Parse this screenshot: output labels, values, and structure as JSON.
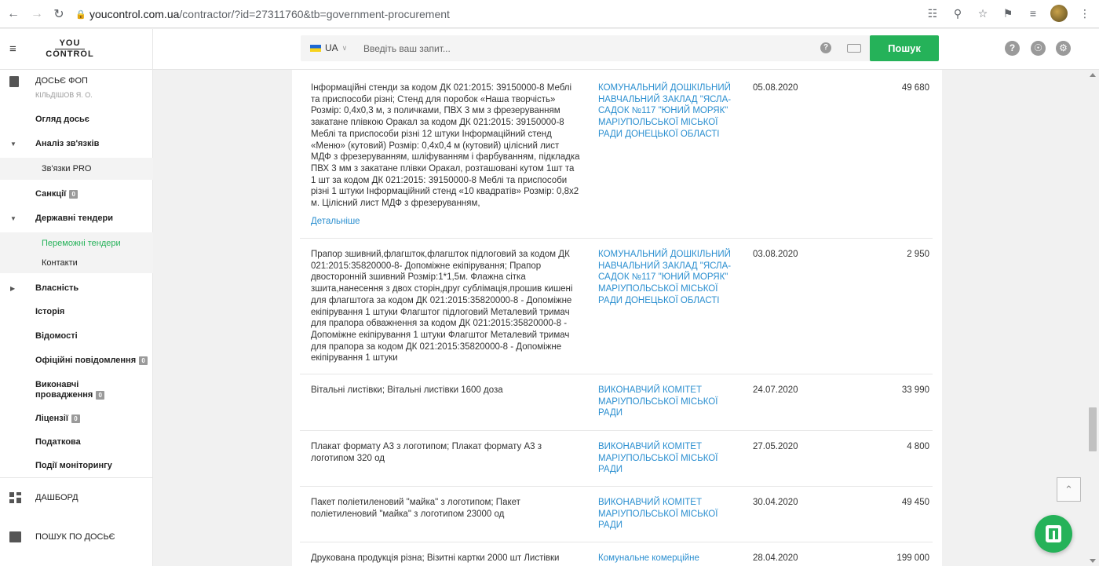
{
  "browser": {
    "url_host": "youcontrol.com.ua",
    "url_path": "/contractor/?id=27311760&tb=government-procurement"
  },
  "header": {
    "logo_top": "YOU",
    "logo_bottom": "CONTROL",
    "lang": "UA",
    "search_placeholder": "Введіть ваш запит...",
    "search_button": "Пошук"
  },
  "sidebar": {
    "dossier_title": "ДОСЬЄ ФОП",
    "dossier_sub": "КІЛЬДІШОВ Я. О.",
    "items": [
      {
        "label": "Огляд досьє"
      },
      {
        "label": "Аналіз зв'язків"
      },
      {
        "label": "Зв'язки PRO"
      },
      {
        "label": "Санкції",
        "badge": "0"
      },
      {
        "label": "Державні тендери"
      },
      {
        "label": "Переможні тендери"
      },
      {
        "label": "Контакти"
      },
      {
        "label": "Власність"
      },
      {
        "label": "Історія"
      },
      {
        "label": "Відомості"
      },
      {
        "label": "Офіційні повідомлення",
        "badge": "0"
      },
      {
        "label_line1": "Виконавчі",
        "label_line2": "провадження",
        "badge": "0"
      },
      {
        "label": "Ліцензії",
        "badge": "0"
      },
      {
        "label": "Податкова"
      },
      {
        "label": "Події моніторингу"
      }
    ],
    "bottom": [
      {
        "label": "ДАШБОРД"
      },
      {
        "label": "ПОШУК ПО ДОСЬЄ"
      }
    ]
  },
  "tenders": {
    "more_label": "Детальніше",
    "rows": [
      {
        "description": "Інформаційні стенди за кодом ДК 021:2015: 39150000-8 Меблі та приспособи різні; Стенд для поробок «Наша творчість» Розмір: 0,4х0,3 м, з поличками, ПВХ 3 мм з фрезеруванням закатане плівкою Оракал за кодом ДК 021:2015: 39150000-8 Меблі та приспособи різні 12 штуки Інформаційний стенд «Меню» (кутовий) Розмір: 0,4х0,4 м (кутовий) цілісний лист МДФ з фрезеруванням, шліфуванням і фарбуванням, підкладка ПВХ 3 мм з закатане плівки Оракал, розташовані кутом 1шт та 1 шт за кодом ДК 021:2015: 39150000-8 Меблі та приспособи різні 1 штуки Інформаційний стенд «10 квадратів» Розмір: 0,8х2 м. Цілісний лист МДФ з фрезеруванням,",
        "organization": "КОМУНАЛЬНИЙ ДОШКІЛЬНИЙ НАВЧАЛЬНИЙ ЗАКЛАД \"ЯСЛА-САДОК №117 \"ЮНИЙ МОРЯК\" МАРІУПОЛЬСЬКОЇ МІСЬКОЇ РАДИ ДОНЕЦЬКОЇ ОБЛАСТІ",
        "date": "05.08.2020",
        "amount": "49 680"
      },
      {
        "description": "Прапор зшивний,флагшток,флагшток підлоговий за кодом ДК 021:2015:35820000-8- Допоміжне екіпірування; Прапор двосторонній зшивний Розмір:1*1,5м. Флажна сітка зшита,нанесення з двох сторін,друг сублімація,прошив кишені для флагштога за кодом ДК 021:2015:35820000-8 - Допоміжне екіпірування 1 штуки Флагштог підлоговий Металевий тримач для прапора обважнення за кодом ДК 021:2015:35820000-8 - Допоміжне екіпірування 1 штуки Флагштог Металевий тримач для прапора за кодом ДК 021:2015:35820000-8 - Допоміжне екіпірування 1 штуки",
        "organization": "КОМУНАЛЬНИЙ ДОШКІЛЬНИЙ НАВЧАЛЬНИЙ ЗАКЛАД \"ЯСЛА-САДОК №117 \"ЮНИЙ МОРЯК\" МАРІУПОЛЬСЬКОЇ МІСЬКОЇ РАДИ ДОНЕЦЬКОЇ ОБЛАСТІ",
        "date": "03.08.2020",
        "amount": "2 950"
      },
      {
        "description": "Вітальні листівки; Вітальні листівки 1600 доза",
        "organization": "ВИКОНАВЧИЙ КОМІТЕТ МАРІУПОЛЬСЬКОЇ МІСЬКОЇ РАДИ",
        "date": "24.07.2020",
        "amount": "33 990"
      },
      {
        "description": "Плакат формату А3 з логотипом; Плакат формату А3 з логотипом 320 од",
        "organization": "ВИКОНАВЧИЙ КОМІТЕТ МАРІУПОЛЬСЬКОЇ МІСЬКОЇ РАДИ",
        "date": "27.05.2020",
        "amount": "4 800"
      },
      {
        "description": "Пакет поліетиленовий \"майка\" з логотипом; Пакет поліетиленовий \"майка\" з логотипом 23000 од",
        "organization": "ВИКОНАВЧИЙ КОМІТЕТ МАРІУПОЛЬСЬКОЇ МІСЬКОЇ РАДИ",
        "date": "30.04.2020",
        "amount": "49 450"
      },
      {
        "description": "Друкована продукція різна; Візитні картки 2000 шт Листівки",
        "organization": "Комунальне комерційне",
        "date": "28.04.2020",
        "amount": "199 000"
      }
    ]
  }
}
